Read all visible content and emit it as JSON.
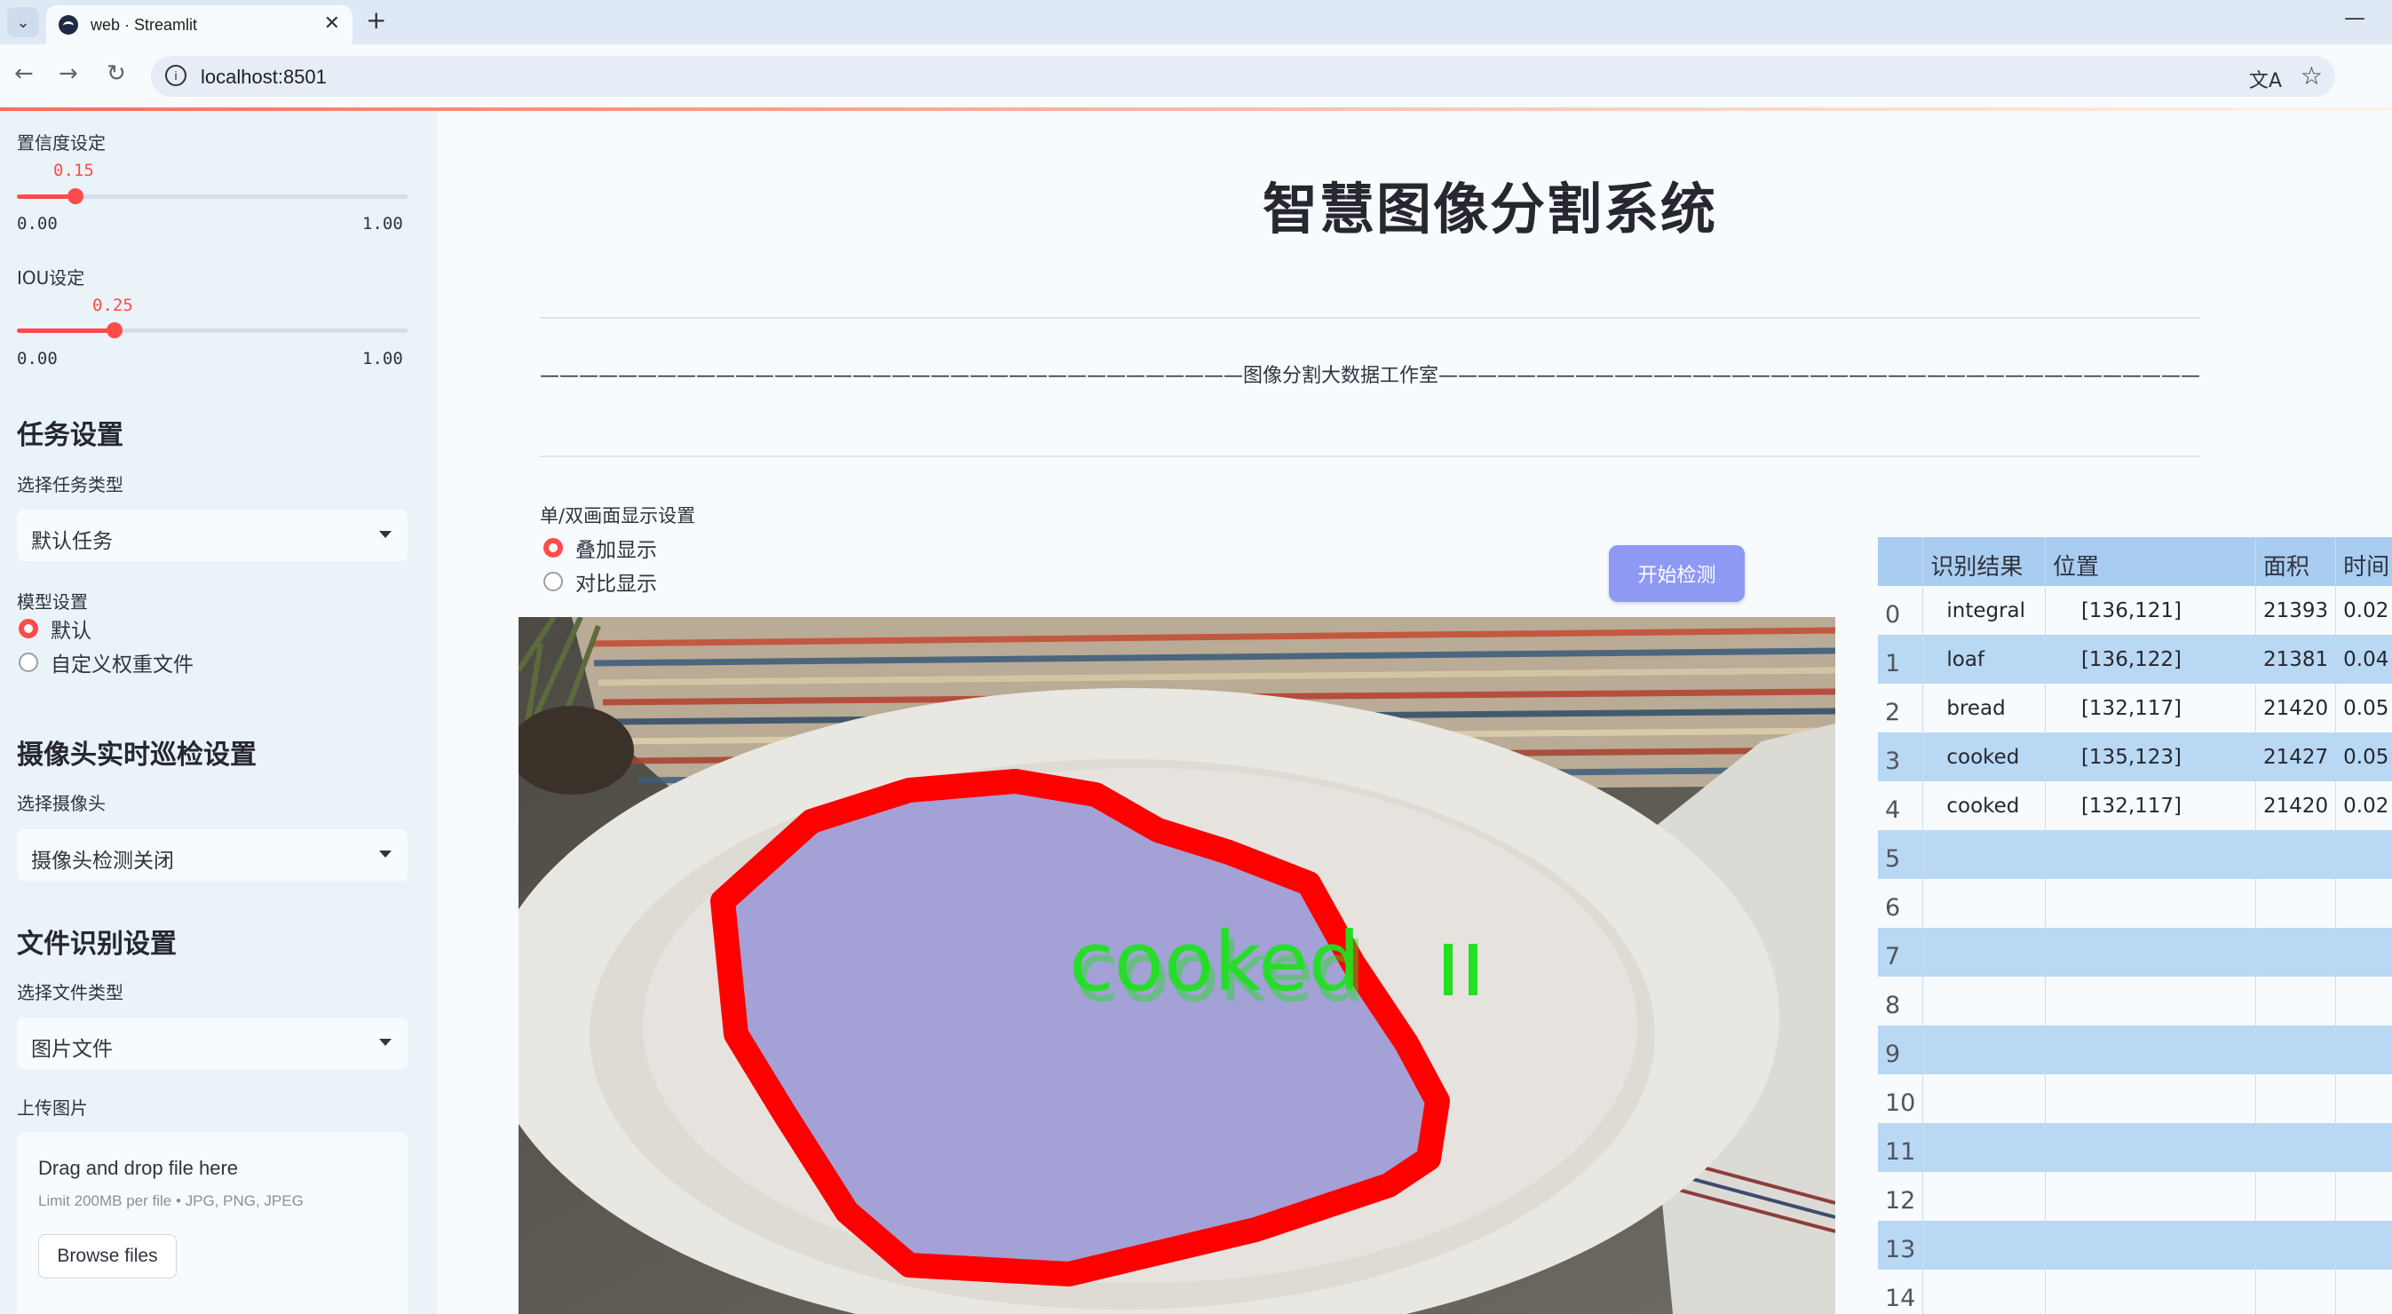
{
  "browser": {
    "tab_title": "web · Streamlit",
    "url": "localhost:8501"
  },
  "sidebar": {
    "confidence": {
      "label": "置信度设定",
      "value": "0.15",
      "min": "0.00",
      "max": "1.00",
      "fraction": 0.15
    },
    "iou": {
      "label": "IOU设定",
      "value": "0.25",
      "min": "0.00",
      "max": "1.00",
      "fraction": 0.25
    },
    "task_heading": "任务设置",
    "task_type_label": "选择任务类型",
    "task_type_value": "默认任务",
    "model_label": "模型设置",
    "model_options": [
      {
        "label": "默认",
        "selected": true
      },
      {
        "label": "自定义权重文件",
        "selected": false
      }
    ],
    "camera_heading": "摄像头实时巡检设置",
    "camera_label": "选择摄像头",
    "camera_value": "摄像头检测关闭",
    "file_heading": "文件识别设置",
    "file_type_label": "选择文件类型",
    "file_type_value": "图片文件",
    "upload_label": "上传图片",
    "upload_title": "Drag and drop file here",
    "upload_limit": "Limit 200MB per file • JPG, PNG, JPEG",
    "browse_label": "Browse files"
  },
  "main": {
    "title": "智慧图像分割系统",
    "divider_text": "————————————————————————————————————图像分割大数据工作室—————————————————————————————————————————",
    "display_label": "单/双画面显示设置",
    "display_options": [
      {
        "label": "叠加显示",
        "selected": true
      },
      {
        "label": "对比显示",
        "selected": false
      }
    ],
    "detect_button": "开始检测",
    "overlay_label": "cooked"
  },
  "table": {
    "headers": [
      "",
      "识别结果",
      "位置",
      "面积",
      "时间"
    ],
    "rows": [
      [
        "0",
        "integral",
        "[136,121]",
        "21393",
        "0.02"
      ],
      [
        "1",
        "loaf",
        "[136,122]",
        "21381",
        "0.04"
      ],
      [
        "2",
        "bread",
        "[132,117]",
        "21420",
        "0.05"
      ],
      [
        "3",
        "cooked",
        "[135,123]",
        "21427",
        "0.05"
      ],
      [
        "4",
        "cooked",
        "[132,117]",
        "21420",
        "0.02"
      ],
      [
        "5",
        "",
        "",
        "",
        ""
      ],
      [
        "6",
        "",
        "",
        "",
        ""
      ],
      [
        "7",
        "",
        "",
        "",
        ""
      ],
      [
        "8",
        "",
        "",
        "",
        ""
      ],
      [
        "9",
        "",
        "",
        "",
        ""
      ],
      [
        "10",
        "",
        "",
        "",
        ""
      ],
      [
        "11",
        "",
        "",
        "",
        ""
      ],
      [
        "12",
        "",
        "",
        "",
        ""
      ],
      [
        "13",
        "",
        "",
        "",
        ""
      ],
      [
        "14",
        "",
        "",
        "",
        ""
      ]
    ]
  },
  "colors": {
    "accent": "#ff4b4b",
    "button": "#8d99f3",
    "mask_fill": "#a3a1d6",
    "mask_outline": "#ff0000",
    "label_text": "#22e022",
    "table_header": "#a9cdf0",
    "table_stripe": "#b9d8f3"
  },
  "icons": {
    "tab_list": "chevron-down-icon",
    "back": "arrow-left-icon",
    "forward": "arrow-right-icon",
    "reload": "reload-icon",
    "info": "info-icon",
    "translate": "translate-icon",
    "bookmark": "star-icon"
  }
}
